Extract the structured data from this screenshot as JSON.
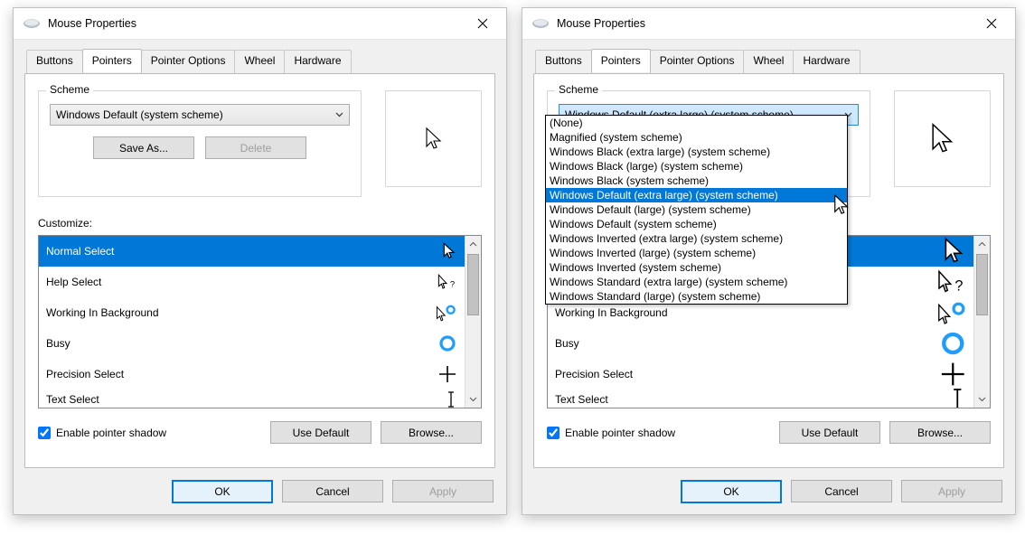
{
  "title": "Mouse Properties",
  "tabs": [
    "Buttons",
    "Pointers",
    "Pointer Options",
    "Wheel",
    "Hardware"
  ],
  "active_tab_index": 1,
  "scheme_label": "Scheme",
  "save_as_label": "Save As...",
  "delete_label": "Delete",
  "customize_label": "Customize:",
  "enable_shadow_label": "Enable pointer shadow",
  "enable_shadow_checked": true,
  "use_default_label": "Use Default",
  "browse_label": "Browse...",
  "ok_label": "OK",
  "cancel_label": "Cancel",
  "apply_label": "Apply",
  "pointer_rows": [
    {
      "name": "Normal Select",
      "icon": "cursor-arrow"
    },
    {
      "name": "Help Select",
      "icon": "cursor-help"
    },
    {
      "name": "Working In Background",
      "icon": "cursor-working"
    },
    {
      "name": "Busy",
      "icon": "cursor-busy"
    },
    {
      "name": "Precision Select",
      "icon": "cursor-cross"
    },
    {
      "name": "Text Select",
      "icon": "cursor-ibeam"
    }
  ],
  "left": {
    "scheme_value": "Windows Default (system scheme)",
    "delete_disabled": true,
    "selected_row_index": 0
  },
  "right": {
    "scheme_value": "Windows Default (extra large) (system scheme)",
    "dropdown_open": true,
    "dropdown_selected_index": 5,
    "dropdown_options": [
      "(None)",
      "Magnified (system scheme)",
      "Windows Black (extra large) (system scheme)",
      "Windows Black (large) (system scheme)",
      "Windows Black (system scheme)",
      "Windows Default (extra large) (system scheme)",
      "Windows Default (large) (system scheme)",
      "Windows Default (system scheme)",
      "Windows Inverted (extra large) (system scheme)",
      "Windows Inverted (large) (system scheme)",
      "Windows Inverted (system scheme)",
      "Windows Standard (extra large) (system scheme)",
      "Windows Standard (large) (system scheme)"
    ],
    "selected_row_index": 0
  }
}
